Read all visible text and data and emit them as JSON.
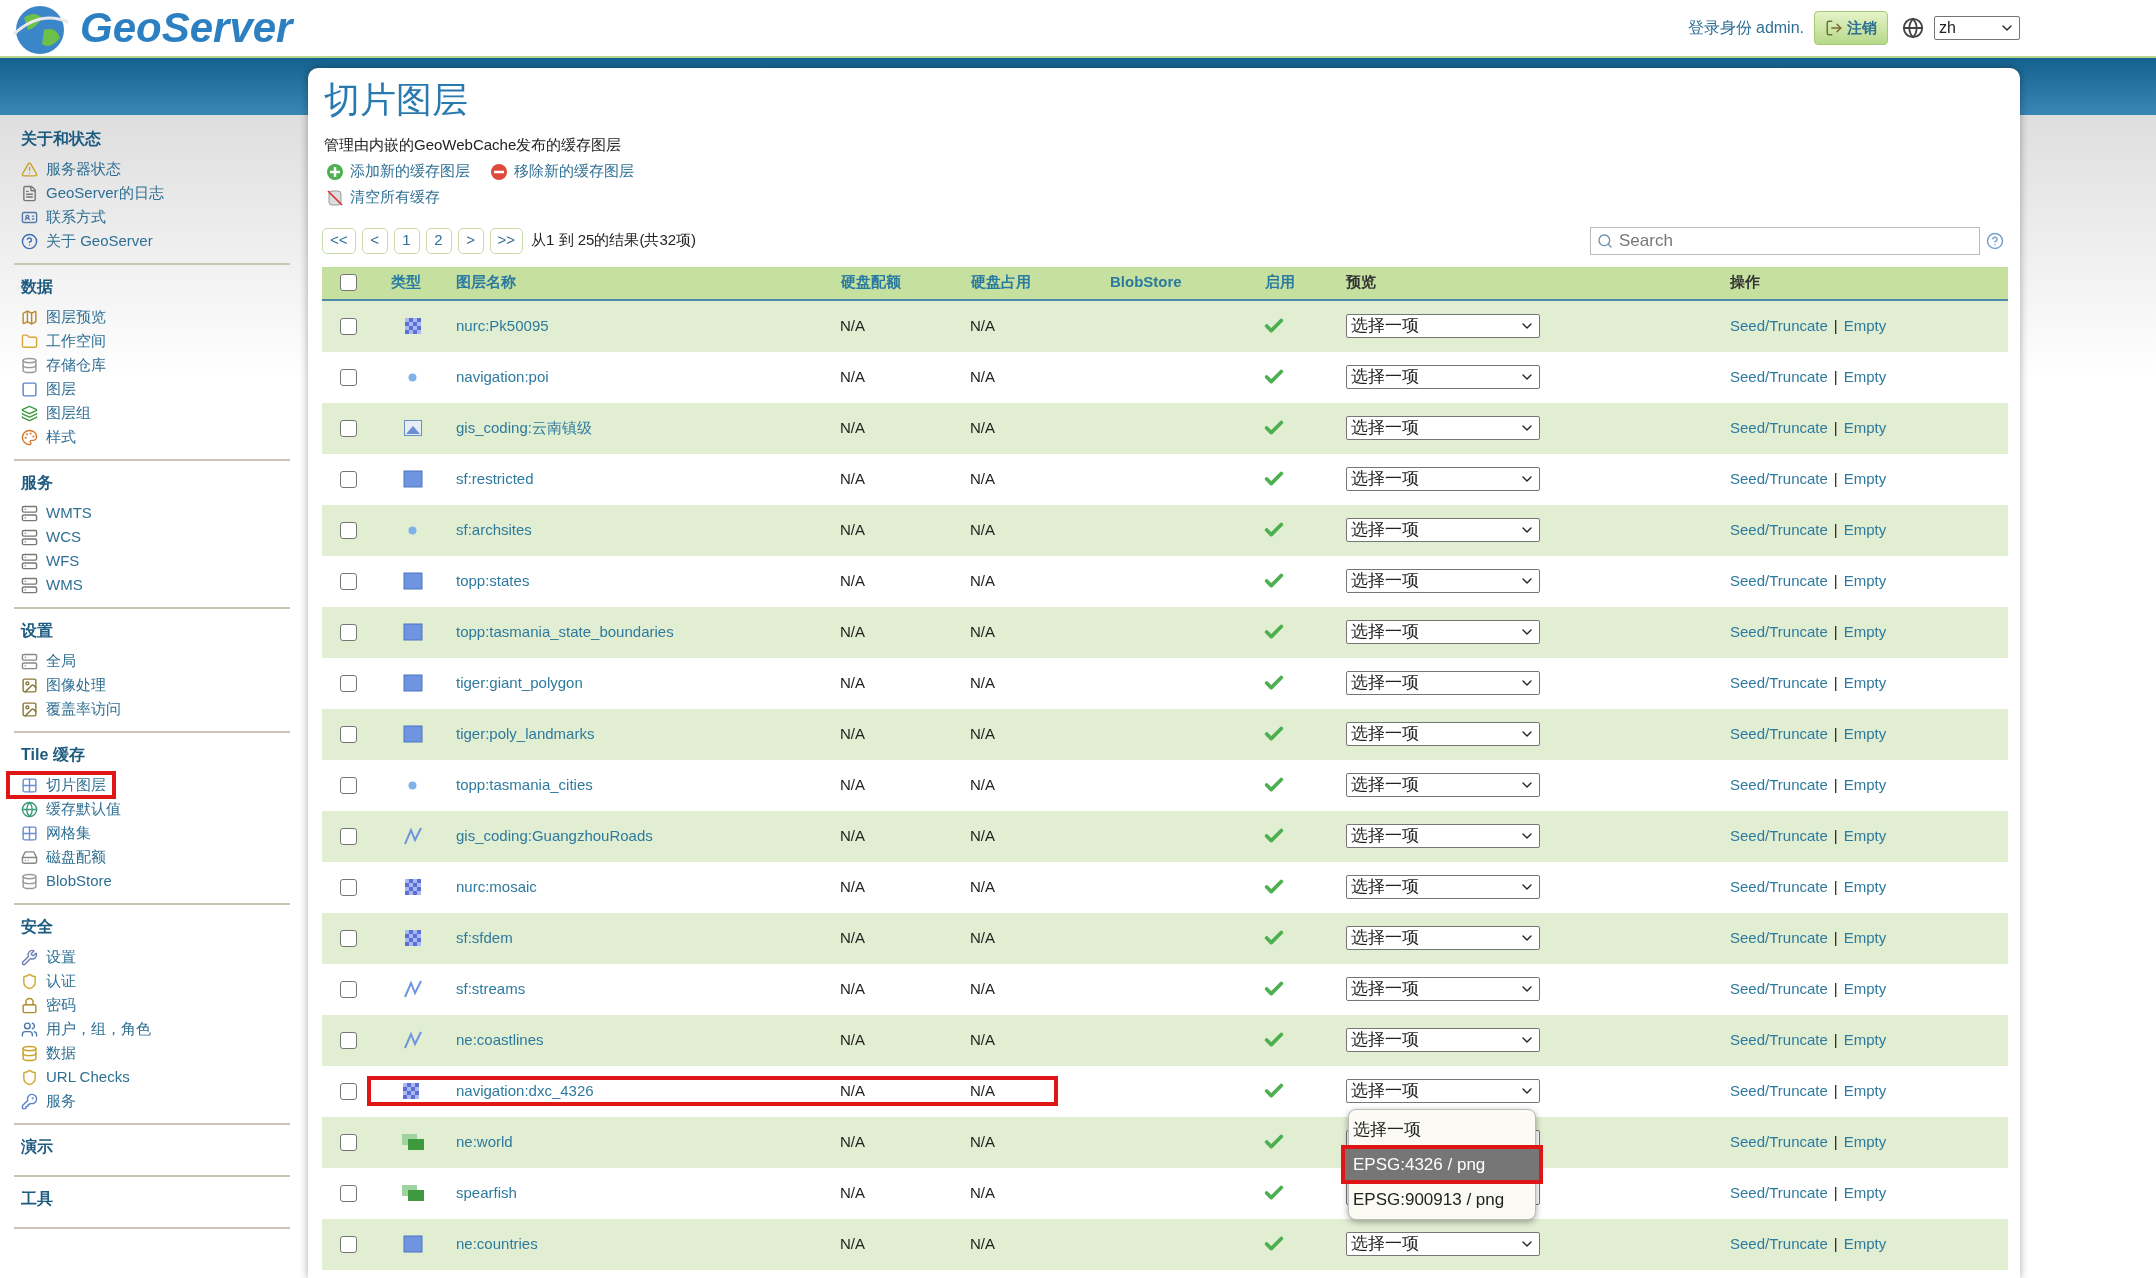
{
  "header": {
    "logo": "GeoServer",
    "login_text": "登录身份 admin.",
    "logout_button": "注销",
    "language": "zh"
  },
  "sidebar": {
    "sections": [
      {
        "title": "关于和状态",
        "items": [
          {
            "label": "服务器状态",
            "annotated": false
          },
          {
            "label": "GeoServer的日志",
            "annotated": false
          },
          {
            "label": "联系方式",
            "annotated": false
          },
          {
            "label": "关于 GeoServer",
            "annotated": false
          }
        ]
      },
      {
        "title": "数据",
        "items": [
          {
            "label": "图层预览",
            "annotated": false
          },
          {
            "label": "工作空间",
            "annotated": false
          },
          {
            "label": "存储仓库",
            "annotated": false
          },
          {
            "label": "图层",
            "annotated": false
          },
          {
            "label": "图层组",
            "annotated": false
          },
          {
            "label": "样式",
            "annotated": false
          }
        ]
      },
      {
        "title": "服务",
        "items": [
          {
            "label": "WMTS",
            "annotated": false
          },
          {
            "label": "WCS",
            "annotated": false
          },
          {
            "label": "WFS",
            "annotated": false
          },
          {
            "label": "WMS",
            "annotated": false
          }
        ]
      },
      {
        "title": "设置",
        "items": [
          {
            "label": "全局",
            "annotated": false
          },
          {
            "label": "图像处理",
            "annotated": false
          },
          {
            "label": "覆盖率访问",
            "annotated": false
          }
        ]
      },
      {
        "title": "Tile 缓存",
        "items": [
          {
            "label": "切片图层",
            "annotated": true
          },
          {
            "label": "缓存默认值",
            "annotated": false
          },
          {
            "label": "网格集",
            "annotated": false
          },
          {
            "label": "磁盘配额",
            "annotated": false
          },
          {
            "label": "BlobStore",
            "annotated": false
          }
        ]
      },
      {
        "title": "安全",
        "items": [
          {
            "label": "设置",
            "annotated": false
          },
          {
            "label": "认证",
            "annotated": false
          },
          {
            "label": "密码",
            "annotated": false
          },
          {
            "label": "用户，组，角色",
            "annotated": false
          },
          {
            "label": "数据",
            "annotated": false
          },
          {
            "label": "URL Checks",
            "annotated": false
          },
          {
            "label": "服务",
            "annotated": false
          }
        ]
      },
      {
        "title": "演示"
      },
      {
        "title": "工具"
      }
    ]
  },
  "page": {
    "title": "切片图层",
    "description": "管理由内嵌的GeoWebCache发布的缓存图层",
    "actions": [
      {
        "kind": "add",
        "label": "添加新的缓存图层"
      },
      {
        "kind": "remove",
        "label": "移除新的缓存图层"
      },
      {
        "kind": "clear",
        "label": "清空所有缓存"
      }
    ]
  },
  "pagination": {
    "buttons": [
      "<<",
      "<",
      "1",
      "2",
      ">",
      ">>"
    ],
    "summary": "从1 到 25的结果(共32项)"
  },
  "search": {
    "placeholder": "Search"
  },
  "table": {
    "select_all": {
      "checked": false
    },
    "columns": [
      {
        "label": "类型",
        "sortable": true
      },
      {
        "label": "图层名称",
        "sortable": true
      },
      {
        "label": "硬盘配额",
        "sortable": true
      },
      {
        "label": "硬盘占用",
        "sortable": true
      },
      {
        "label": "BlobStore",
        "sortable": true
      },
      {
        "label": "启用",
        "sortable": true
      },
      {
        "label": "预览",
        "sortable": false
      },
      {
        "label": "操作",
        "sortable": false
      }
    ],
    "rows": [
      {
        "checked": false,
        "kind": "raster",
        "name": "nurc:Pk50095",
        "quota": "N/A",
        "usage": "N/A",
        "enabled": true,
        "preview": "选择一项",
        "seed": "Seed/Truncate",
        "separator": "|",
        "empty": "Empty",
        "annotated": false
      },
      {
        "checked": false,
        "kind": "point",
        "name": "navigation:poi",
        "quota": "N/A",
        "usage": "N/A",
        "enabled": true,
        "preview": "选择一项",
        "seed": "Seed/Truncate",
        "separator": "|",
        "empty": "Empty",
        "annotated": false
      },
      {
        "checked": false,
        "kind": "image",
        "name": "gis_coding:云南镇级",
        "quota": "N/A",
        "usage": "N/A",
        "enabled": true,
        "preview": "选择一项",
        "seed": "Seed/Truncate",
        "separator": "|",
        "empty": "Empty",
        "annotated": false
      },
      {
        "checked": false,
        "kind": "polygon",
        "name": "sf:restricted",
        "quota": "N/A",
        "usage": "N/A",
        "enabled": true,
        "preview": "选择一项",
        "seed": "Seed/Truncate",
        "separator": "|",
        "empty": "Empty",
        "annotated": false
      },
      {
        "checked": false,
        "kind": "point",
        "name": "sf:archsites",
        "quota": "N/A",
        "usage": "N/A",
        "enabled": true,
        "preview": "选择一项",
        "seed": "Seed/Truncate",
        "separator": "|",
        "empty": "Empty",
        "annotated": false
      },
      {
        "checked": false,
        "kind": "polygon",
        "name": "topp:states",
        "quota": "N/A",
        "usage": "N/A",
        "enabled": true,
        "preview": "选择一项",
        "seed": "Seed/Truncate",
        "separator": "|",
        "empty": "Empty",
        "annotated": false
      },
      {
        "checked": false,
        "kind": "polygon",
        "name": "topp:tasmania_state_boundaries",
        "quota": "N/A",
        "usage": "N/A",
        "enabled": true,
        "preview": "选择一项",
        "seed": "Seed/Truncate",
        "separator": "|",
        "empty": "Empty",
        "annotated": false
      },
      {
        "checked": false,
        "kind": "polygon",
        "name": "tiger:giant_polygon",
        "quota": "N/A",
        "usage": "N/A",
        "enabled": true,
        "preview": "选择一项",
        "seed": "Seed/Truncate",
        "separator": "|",
        "empty": "Empty",
        "annotated": false
      },
      {
        "checked": false,
        "kind": "polygon",
        "name": "tiger:poly_landmarks",
        "quota": "N/A",
        "usage": "N/A",
        "enabled": true,
        "preview": "选择一项",
        "seed": "Seed/Truncate",
        "separator": "|",
        "empty": "Empty",
        "annotated": false
      },
      {
        "checked": false,
        "kind": "point",
        "name": "topp:tasmania_cities",
        "quota": "N/A",
        "usage": "N/A",
        "enabled": true,
        "preview": "选择一项",
        "seed": "Seed/Truncate",
        "separator": "|",
        "empty": "Empty",
        "annotated": false
      },
      {
        "checked": false,
        "kind": "line",
        "name": "gis_coding:GuangzhouRoads",
        "quota": "N/A",
        "usage": "N/A",
        "enabled": true,
        "preview": "选择一项",
        "seed": "Seed/Truncate",
        "separator": "|",
        "empty": "Empty",
        "annotated": false
      },
      {
        "checked": false,
        "kind": "raster",
        "name": "nurc:mosaic",
        "quota": "N/A",
        "usage": "N/A",
        "enabled": true,
        "preview": "选择一项",
        "seed": "Seed/Truncate",
        "separator": "|",
        "empty": "Empty",
        "annotated": false
      },
      {
        "checked": false,
        "kind": "raster",
        "name": "sf:sfdem",
        "quota": "N/A",
        "usage": "N/A",
        "enabled": true,
        "preview": "选择一项",
        "seed": "Seed/Truncate",
        "separator": "|",
        "empty": "Empty",
        "annotated": false
      },
      {
        "checked": false,
        "kind": "line",
        "name": "sf:streams",
        "quota": "N/A",
        "usage": "N/A",
        "enabled": true,
        "preview": "选择一项",
        "seed": "Seed/Truncate",
        "separator": "|",
        "empty": "Empty",
        "annotated": false
      },
      {
        "checked": false,
        "kind": "line",
        "name": "ne:coastlines",
        "quota": "N/A",
        "usage": "N/A",
        "enabled": true,
        "preview": "选择一项",
        "seed": "Seed/Truncate",
        "separator": "|",
        "empty": "Empty",
        "annotated": false
      },
      {
        "checked": false,
        "kind": "raster",
        "name": "navigation:dxc_4326",
        "quota": "N/A",
        "usage": "N/A",
        "enabled": true,
        "preview": "选择一项",
        "seed": "Seed/Truncate",
        "separator": "|",
        "empty": "Empty",
        "annotated": true,
        "menu": {
          "options": [
            {
              "label": "选择一项",
              "selected": false,
              "annotated": false
            },
            {
              "label": "EPSG:4326 / png",
              "selected": true,
              "annotated": true
            },
            {
              "label": "EPSG:900913 / png",
              "selected": false,
              "annotated": false
            }
          ]
        }
      },
      {
        "checked": false,
        "kind": "group",
        "name": "ne:world",
        "quota": "N/A",
        "usage": "N/A",
        "enabled": true,
        "seed": "Seed/Truncate",
        "separator": "|",
        "empty": "Empty",
        "annotated": false
      },
      {
        "checked": false,
        "kind": "group",
        "name": "spearfish",
        "quota": "N/A",
        "usage": "N/A",
        "enabled": true,
        "seed": "Seed/Truncate",
        "separator": "|",
        "empty": "Empty",
        "annotated": false
      },
      {
        "checked": false,
        "kind": "polygon",
        "name": "ne:countries",
        "quota": "N/A",
        "usage": "N/A",
        "enabled": true,
        "preview": "选择一项",
        "seed": "Seed/Truncate",
        "separator": "|",
        "empty": "Empty",
        "annotated": false
      }
    ]
  }
}
